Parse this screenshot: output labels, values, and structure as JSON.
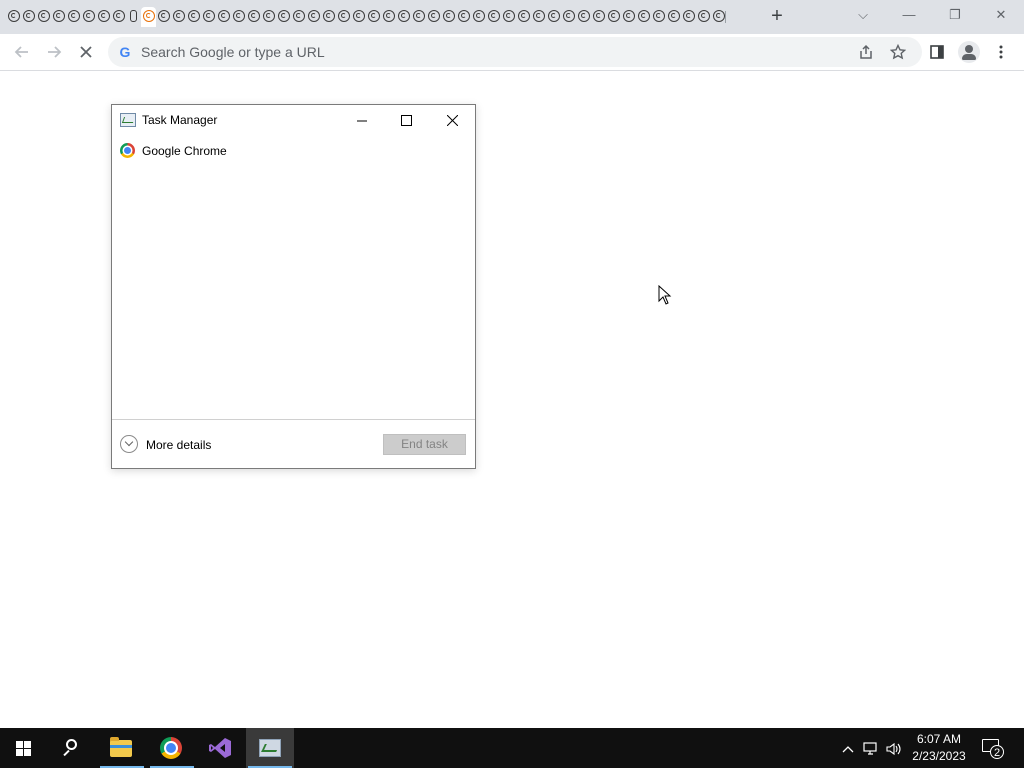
{
  "browser": {
    "tab_count": 48,
    "active_tab_index": 9,
    "muted_tab_index": 8,
    "new_tab_label": "+",
    "window_controls": {
      "dropdown": "⌵",
      "minimize": "—",
      "restore": "❐",
      "close": "✕"
    },
    "toolbar": {
      "back_icon": "arrow-left-icon",
      "forward_icon": "arrow-right-icon",
      "reload_icon": "stop-loading-icon",
      "omnibox_placeholder": "Search Google or type a URL",
      "omnibox_value": "",
      "google_glyph": "G"
    }
  },
  "task_manager": {
    "title": "Task Manager",
    "processes": [
      {
        "name": "Google Chrome",
        "icon": "chrome-icon"
      }
    ],
    "more_details_label": "More details",
    "end_task_label": "End task",
    "end_task_enabled": false
  },
  "taskbar": {
    "pinned": [
      "start",
      "search",
      "file-explorer",
      "google-chrome",
      "visual-studio",
      "task-manager"
    ],
    "clock_time": "6:07 AM",
    "clock_date": "2/23/2023",
    "notification_count": "2"
  },
  "colors": {
    "tabstrip": "#dee1e6",
    "omnibox": "#f1f3f4",
    "taskbar": "#101010",
    "active_accent": "#76b9ed"
  }
}
